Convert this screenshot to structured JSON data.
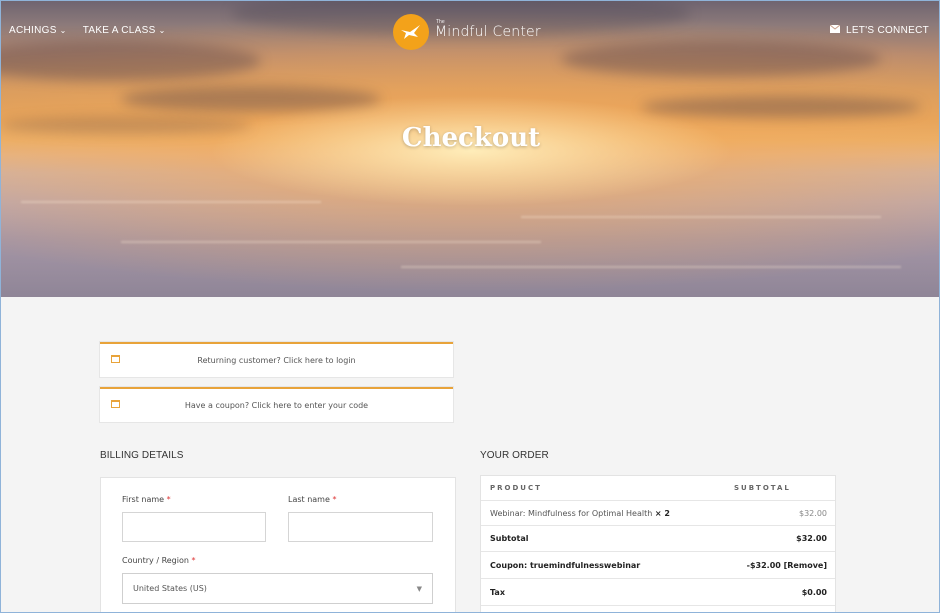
{
  "nav": {
    "items": [
      {
        "label": "ACHINGS"
      },
      {
        "label": "TAKE A CLASS"
      }
    ],
    "connect_label": "LET'S CONNECT",
    "connect_icon": "envelope-icon"
  },
  "logo": {
    "small": "The",
    "name": "Mindful Center",
    "icon": "bird-icon",
    "color": "#f3a21a"
  },
  "hero": {
    "title": "Checkout"
  },
  "notices": {
    "login": "Returning customer? Click here to login",
    "coupon": "Have a coupon? Click here to enter your code",
    "accent": "#e8a33a"
  },
  "billing": {
    "heading": "BILLING DETAILS",
    "first_name_label": "First name",
    "last_name_label": "Last name",
    "country_label": "Country / Region",
    "required_mark": "*",
    "country_value": "United States (US)"
  },
  "order": {
    "heading": "YOUR ORDER",
    "col_product": "PRODUCT",
    "col_subtotal": "SUBTOTAL",
    "item_name": "Webinar: Mindfulness for Optimal Health",
    "item_qty": "× 2",
    "item_price": "$32.00",
    "subtotal_label": "Subtotal",
    "subtotal_value": "$32.00",
    "coupon_label": "Coupon: truemindfulnesswebinar",
    "coupon_value": "-$32.00 [Remove]",
    "tax_label": "Tax",
    "tax_value": "$0.00"
  }
}
